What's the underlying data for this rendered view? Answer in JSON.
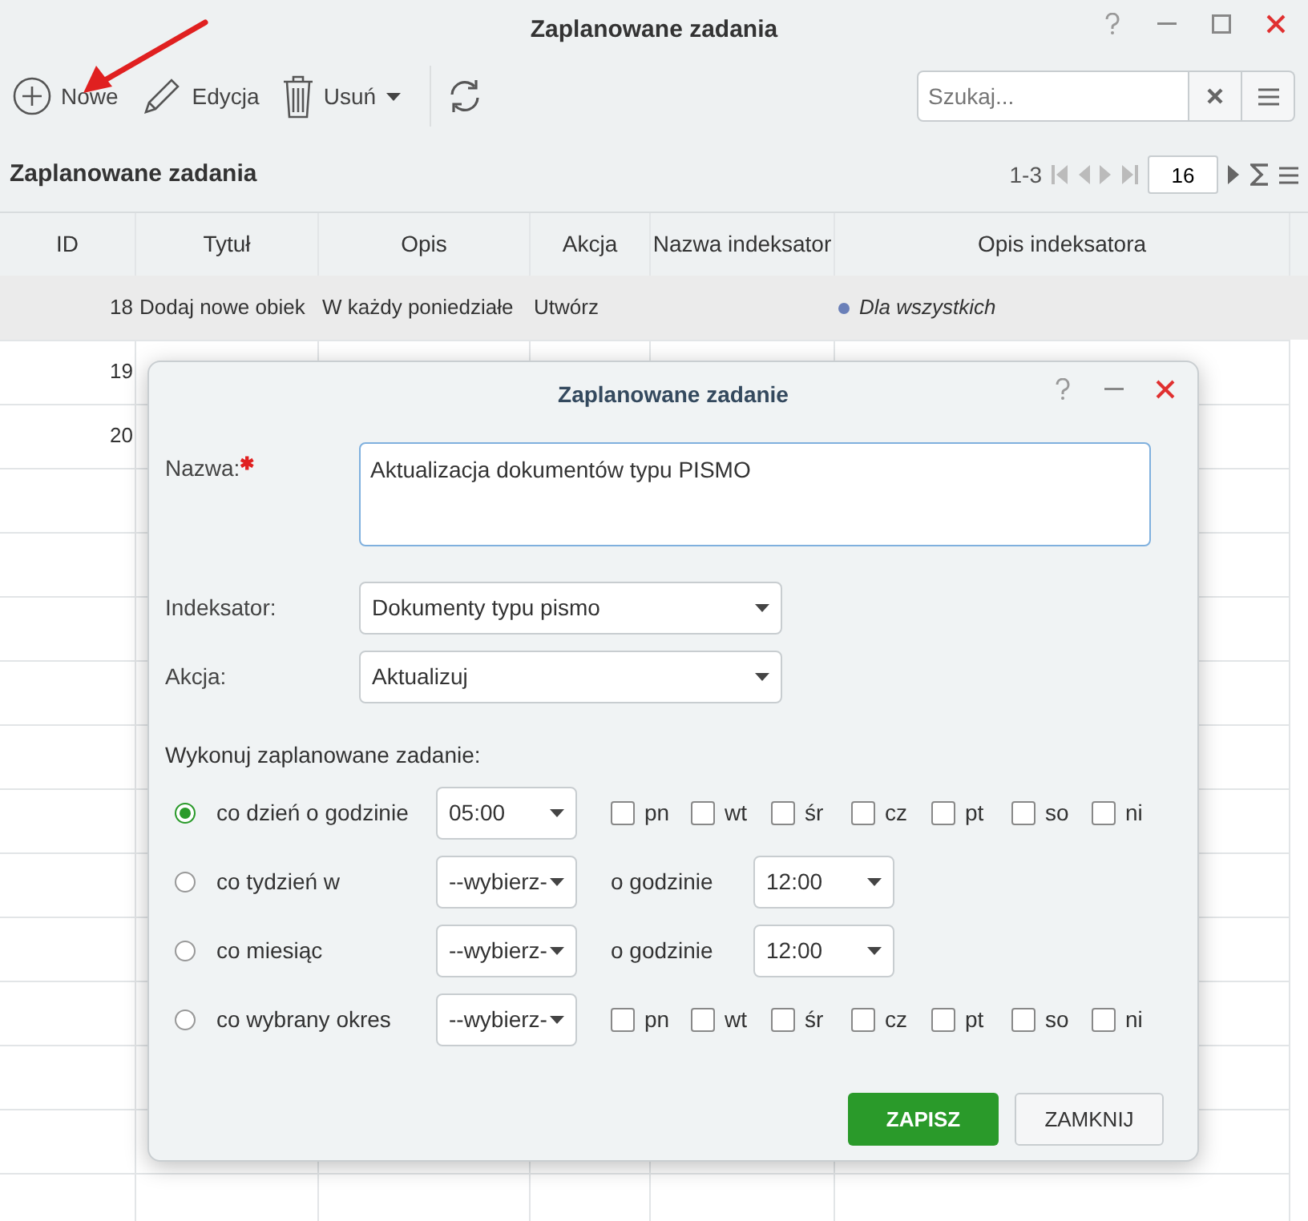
{
  "window": {
    "title": "Zaplanowane zadania"
  },
  "toolbar": {
    "buttons": [
      {
        "kind": "add",
        "label": "Nowe"
      },
      {
        "kind": "edit",
        "label": "Edycja"
      },
      {
        "kind": "delete",
        "label": "Usuń",
        "dropdown": true
      },
      {
        "kind": "refresh"
      }
    ],
    "search": {
      "placeholder": "Szukaj..."
    }
  },
  "grid": {
    "title": "Zaplanowane zadania",
    "range": "1-3",
    "page_size": "16",
    "columns": [
      "ID",
      "Tytuł",
      "Opis",
      "Akcja",
      "Nazwa indeksator",
      "Opis indeksatora"
    ],
    "rows": [
      {
        "selected": true,
        "cells": [
          "18",
          "Dodaj nowe obiek",
          "W każdy poniedziałe",
          "Utwórz",
          "",
          "Dla wszystkich"
        ]
      },
      {
        "selected": false,
        "cells": [
          "19",
          "",
          "",
          "",
          "",
          ""
        ]
      },
      {
        "selected": false,
        "cells": [
          "20",
          "",
          "",
          "",
          "",
          ""
        ]
      }
    ]
  },
  "dialog": {
    "title": "Zaplanowane zadanie",
    "name": {
      "label": "Nazwa:",
      "required_mark": "✱",
      "value": "Aktualizacja dokumentów typu PISMO"
    },
    "indexer": {
      "label": "Indeksator:",
      "value": "Dokumenty typu pismo"
    },
    "action": {
      "label": "Akcja:",
      "value": "Aktualizuj"
    },
    "schedule_label": "Wykonuj zaplanowane zadanie:",
    "options": [
      {
        "kind": "days",
        "label": "co dzień o godzinie",
        "selected": true,
        "value": "05:00",
        "days": [
          {
            "label": "pn",
            "checked": false
          },
          {
            "label": "wt",
            "checked": false
          },
          {
            "label": "śr",
            "checked": false
          },
          {
            "label": "cz",
            "checked": false
          },
          {
            "label": "pt",
            "checked": false
          },
          {
            "label": "so",
            "checked": false
          },
          {
            "label": "ni",
            "checked": false
          }
        ]
      },
      {
        "kind": "time",
        "label": "co tydzień w",
        "selected": false,
        "value": "--wybierz-",
        "time_label": "o godzinie",
        "time_value": "12:00"
      },
      {
        "kind": "time",
        "label": "co miesiąc",
        "selected": false,
        "value": "--wybierz-",
        "time_label": "o godzinie",
        "time_value": "12:00"
      },
      {
        "kind": "days",
        "label": "co wybrany okres",
        "selected": false,
        "value": "--wybierz-",
        "days": [
          {
            "label": "pn",
            "checked": false
          },
          {
            "label": "wt",
            "checked": false
          },
          {
            "label": "śr",
            "checked": false
          },
          {
            "label": "cz",
            "checked": false
          },
          {
            "label": "pt",
            "checked": false
          },
          {
            "label": "so",
            "checked": false
          },
          {
            "label": "ni",
            "checked": false
          }
        ]
      }
    ],
    "buttons": [
      {
        "kind": "primary",
        "label": "ZAPISZ"
      },
      {
        "kind": "secondary",
        "label": "ZAMKNIJ"
      }
    ]
  }
}
